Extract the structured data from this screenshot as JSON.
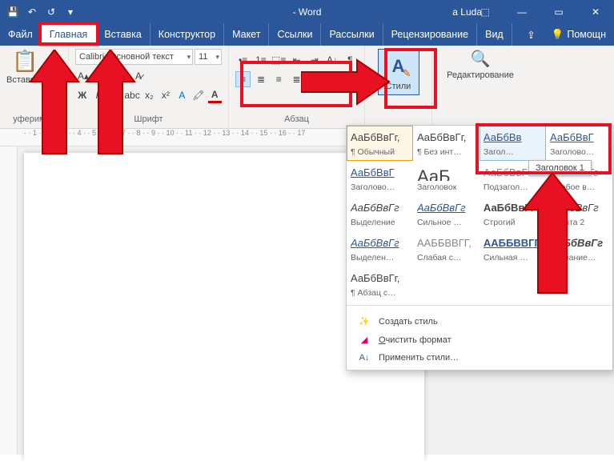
{
  "app": {
    "title": "- Word",
    "user": "a Luda"
  },
  "qat": {
    "save": "💾",
    "undo": "↶",
    "redo": "↺",
    "more": "▾"
  },
  "winbuttons": {
    "ribbonopts": "⬚",
    "min": "—",
    "max": "▭",
    "close": "✕"
  },
  "tabs": {
    "file": "Файл",
    "home": "Главная",
    "insert": "Вставка",
    "design": "Конструктор",
    "layout": "Макет",
    "references": "Ссылки",
    "mailings": "Рассылки",
    "review": "Рецензирование",
    "view": "Вид",
    "share": "⇪",
    "help": "Помощн"
  },
  "ribbon": {
    "clipboard": {
      "paste": "Вставить",
      "label": "уферимна"
    },
    "font": {
      "name": "Calibri (Основной текст",
      "size": "11",
      "label": "Шрифт"
    },
    "paragraph": {
      "label": "Абзац"
    },
    "styles": {
      "label": "Стили"
    },
    "editing": {
      "label": "Редактирование"
    }
  },
  "tooltip": "Заголовок 1",
  "gallery": {
    "rows": [
      [
        {
          "preview": "АаБбВвГг,",
          "name": "¶ Обычный",
          "cls": "sel"
        },
        {
          "preview": "АаБбВвГг,",
          "name": "¶ Без инт…"
        },
        {
          "preview": "АаБбВв",
          "name": "Загол…",
          "cls": "hover blue"
        },
        {
          "preview": "АаБбВвГ",
          "name": "Заголово…",
          "cls": "blue"
        }
      ],
      [
        {
          "preview": "АаБбВвГ",
          "name": "Заголово…",
          "cls": "blue"
        },
        {
          "preview": "АаБ",
          "name": "Заголовок",
          "big": true
        },
        {
          "preview": "АаБбВвГ",
          "name": "Подзагол…",
          "cls": "gray"
        },
        {
          "preview": "АаБбВвГг",
          "name": "Слабое в…",
          "cls": "ita gray"
        }
      ],
      [
        {
          "preview": "АаБбВвГг",
          "name": "Выделение",
          "cls": "ita"
        },
        {
          "preview": "АаБбВвГг",
          "name": "Сильное …",
          "cls": "ita blue"
        },
        {
          "preview": "АаБбВвГг",
          "name": "Строгий",
          "cls": "bold"
        },
        {
          "preview": "АаБбВвГг",
          "name": "Цитата 2",
          "cls": "ita"
        }
      ],
      [
        {
          "preview": "АаБбВвГг",
          "name": "Выделен…",
          "cls": "ita blue u"
        },
        {
          "preview": "ААББВВГГ,",
          "name": "Слабая с…",
          "cls": "gray"
        },
        {
          "preview": "ААББВВГГ,",
          "name": "Сильная …",
          "cls": "bold blue"
        },
        {
          "preview": "АаБбВвГг",
          "name": "Название…",
          "cls": "bold ita"
        }
      ],
      [
        {
          "preview": "АаБбВвГг,",
          "name": "¶ Абзац с…"
        },
        {
          "preview": "",
          "name": ""
        },
        {
          "preview": "",
          "name": ""
        },
        {
          "preview": "",
          "name": ""
        }
      ]
    ],
    "menu": {
      "create": "Создать стиль",
      "clear": "Очистить формат",
      "apply": "Применить стили…"
    }
  }
}
